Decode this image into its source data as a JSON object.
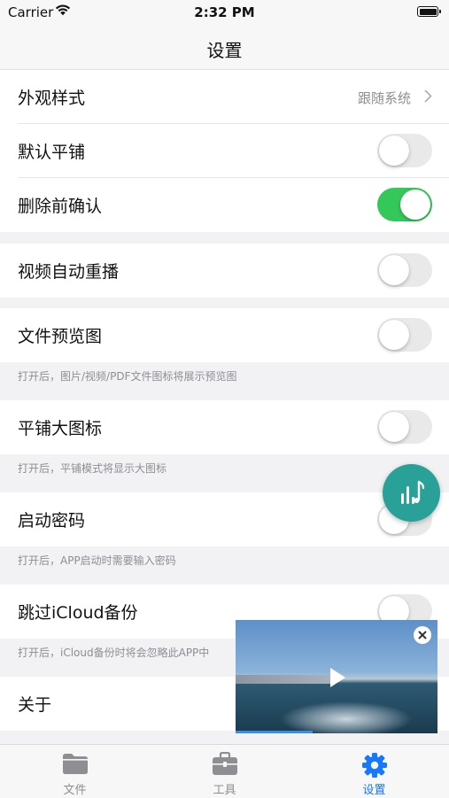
{
  "status_bar": {
    "carrier": "Carrier",
    "time": "2:32 PM"
  },
  "nav": {
    "title": "设置"
  },
  "rows": {
    "appearance": {
      "label": "外观样式",
      "value": "跟随系统"
    },
    "default_tile": {
      "label": "默认平铺",
      "on": false
    },
    "confirm_delete": {
      "label": "删除前确认",
      "on": true
    },
    "video_autoreplay": {
      "label": "视频自动重播",
      "on": false
    },
    "file_preview": {
      "label": "文件预览图",
      "on": false,
      "note": "打开后，图片/视频/PDF文件图标将展示预览图"
    },
    "large_tile_icons": {
      "label": "平铺大图标",
      "on": false,
      "note": "打开后，平铺模式将显示大图标"
    },
    "launch_passcode": {
      "label": "启动密码",
      "on": false,
      "note": "打开后，APP启动时需要输入密码"
    },
    "skip_icloud": {
      "label": "跳过iCloud备份",
      "on": false,
      "note": "打开后，iCloud备份时将会忽略此APP中"
    },
    "about": {
      "label": "关于"
    }
  },
  "colors": {
    "toggle_on": "#34c759",
    "accent": "#1677ff",
    "fab": "#2aa198"
  },
  "tabs": [
    {
      "label": "文件",
      "icon": "folder-icon",
      "active": false
    },
    {
      "label": "工具",
      "icon": "toolbox-icon",
      "active": false
    },
    {
      "label": "设置",
      "icon": "gear-icon",
      "active": true
    }
  ]
}
